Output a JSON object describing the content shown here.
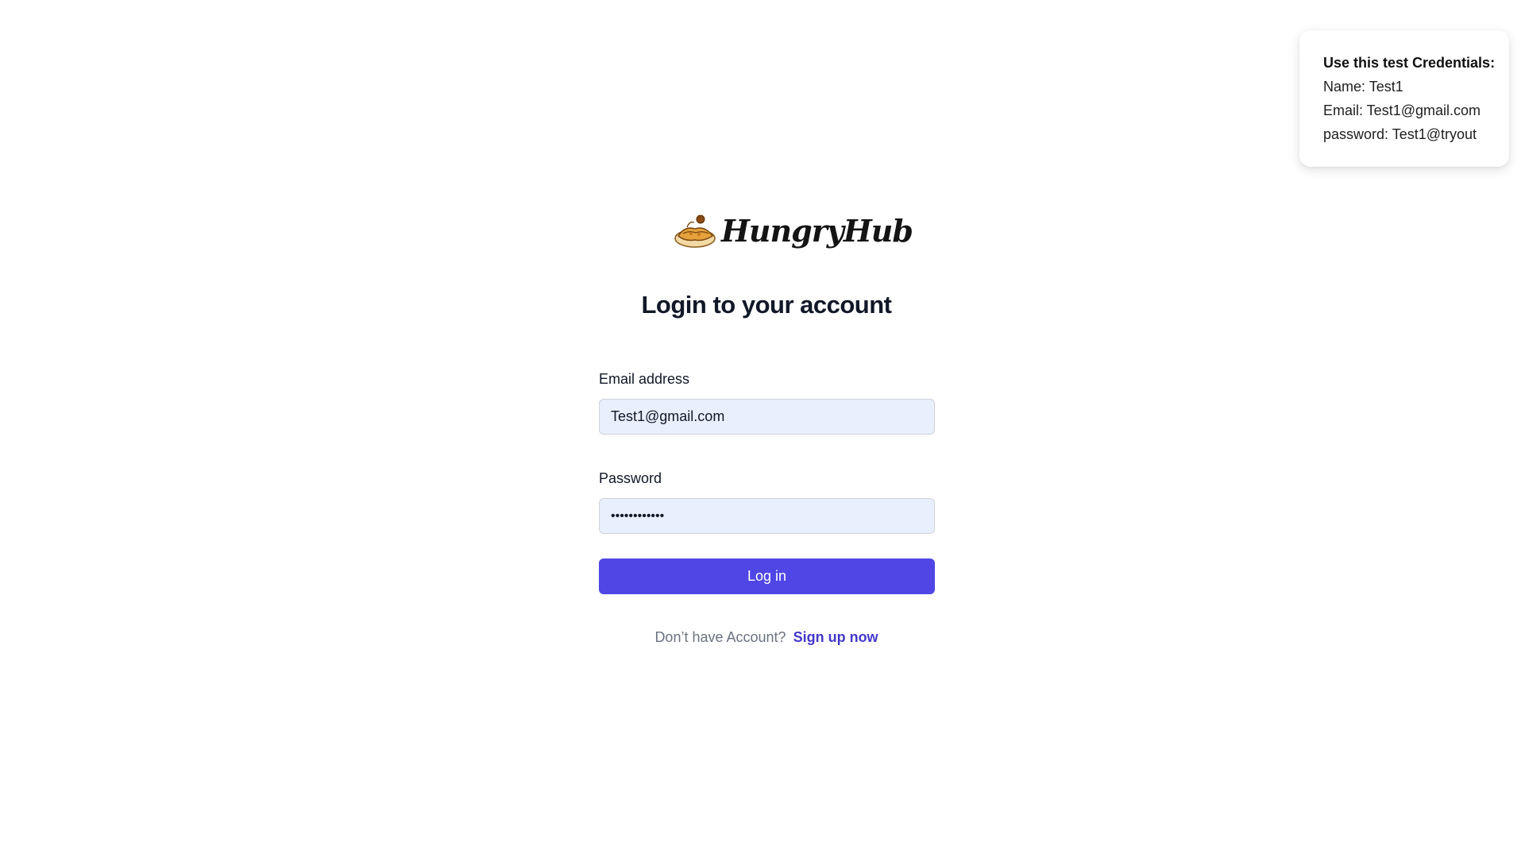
{
  "credentials_card": {
    "title": "Use this test Credentials:",
    "name_line": "Name: Test1",
    "email_line": "Email: Test1@gmail.com",
    "password_line": "password: Test1@tryout"
  },
  "logo": {
    "text": "HungryHub",
    "icon": "food-bowl-icon"
  },
  "page_title": "Login to your account",
  "form": {
    "email_label": "Email address",
    "email_value": "Test1@gmail.com",
    "password_label": "Password",
    "password_value": "Test1@tryout",
    "login_label": "Log in"
  },
  "signup": {
    "prompt": "Don’t have Account?",
    "link_label": "Sign up now"
  },
  "colors": {
    "accent": "#4f46e5",
    "link": "#4338ca",
    "input_bg": "#e8effd"
  }
}
